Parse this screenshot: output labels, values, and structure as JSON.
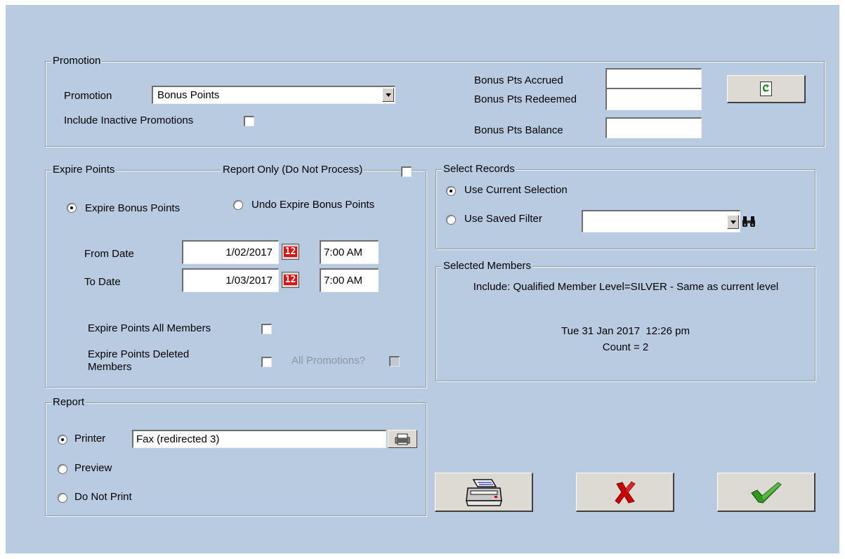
{
  "promotion": {
    "legend": "Promotion",
    "promotion_label": "Promotion",
    "promotion_value": "Bonus Points",
    "include_inactive_label": "Include Inactive Promotions",
    "include_inactive_checked": false,
    "accrued_label": "Bonus Pts Accrued",
    "redeemed_label": "Bonus Pts Redeemed",
    "balance_label": "Bonus Pts Balance",
    "accrued_value": "",
    "redeemed_value": "",
    "balance_value": "",
    "refresh_icon": "refresh-icon"
  },
  "expire": {
    "legend": "Expire Points",
    "report_only_label": "Report Only (Do Not Process)",
    "report_only_checked": false,
    "expire_bonus_label": "Expire Bonus Points",
    "undo_expire_label": "Undo Expire Bonus Points",
    "selected_mode": "Expire Bonus Points",
    "from_date_label": "From Date",
    "from_date_value": "1/02/2017",
    "from_time_value": "7:00 AM",
    "to_date_label": "To Date",
    "to_date_value": "1/03/2017",
    "to_time_value": "7:00 AM",
    "calendar_icon_text": "12",
    "all_members_label": "Expire Points All Members",
    "all_members_checked": false,
    "deleted_members_label": "Expire Points Deleted Members",
    "deleted_members_checked": false,
    "all_promotions_label": "All Promotions?",
    "all_promotions_checked": false
  },
  "select_records": {
    "legend": "Select Records",
    "use_current_label": "Use Current Selection",
    "use_saved_label": "Use Saved Filter",
    "selected_option": "Use Current Selection",
    "saved_filter_value": "",
    "find_icon": "binoculars-icon"
  },
  "selected_members": {
    "legend": "Selected Members",
    "criteria": "Include: Qualified Member Level=SILVER - Same as current level",
    "timestamp": "Tue 31 Jan 2017  12:26 pm",
    "count": "Count = 2"
  },
  "report": {
    "legend": "Report",
    "printer_label": "Printer",
    "preview_label": "Preview",
    "do_not_print_label": "Do Not Print",
    "selected_option": "Printer",
    "printer_value": "Fax (redirected 3)",
    "printer_setup_icon": "printer-setup-icon"
  },
  "actions": {
    "print_icon": "printer-icon",
    "cancel_icon": "red-x-icon",
    "ok_icon": "green-check-icon"
  },
  "colors": {
    "background": "#b9cbe1",
    "cancel": "#cc0000",
    "ok": "#2f9a1f"
  }
}
